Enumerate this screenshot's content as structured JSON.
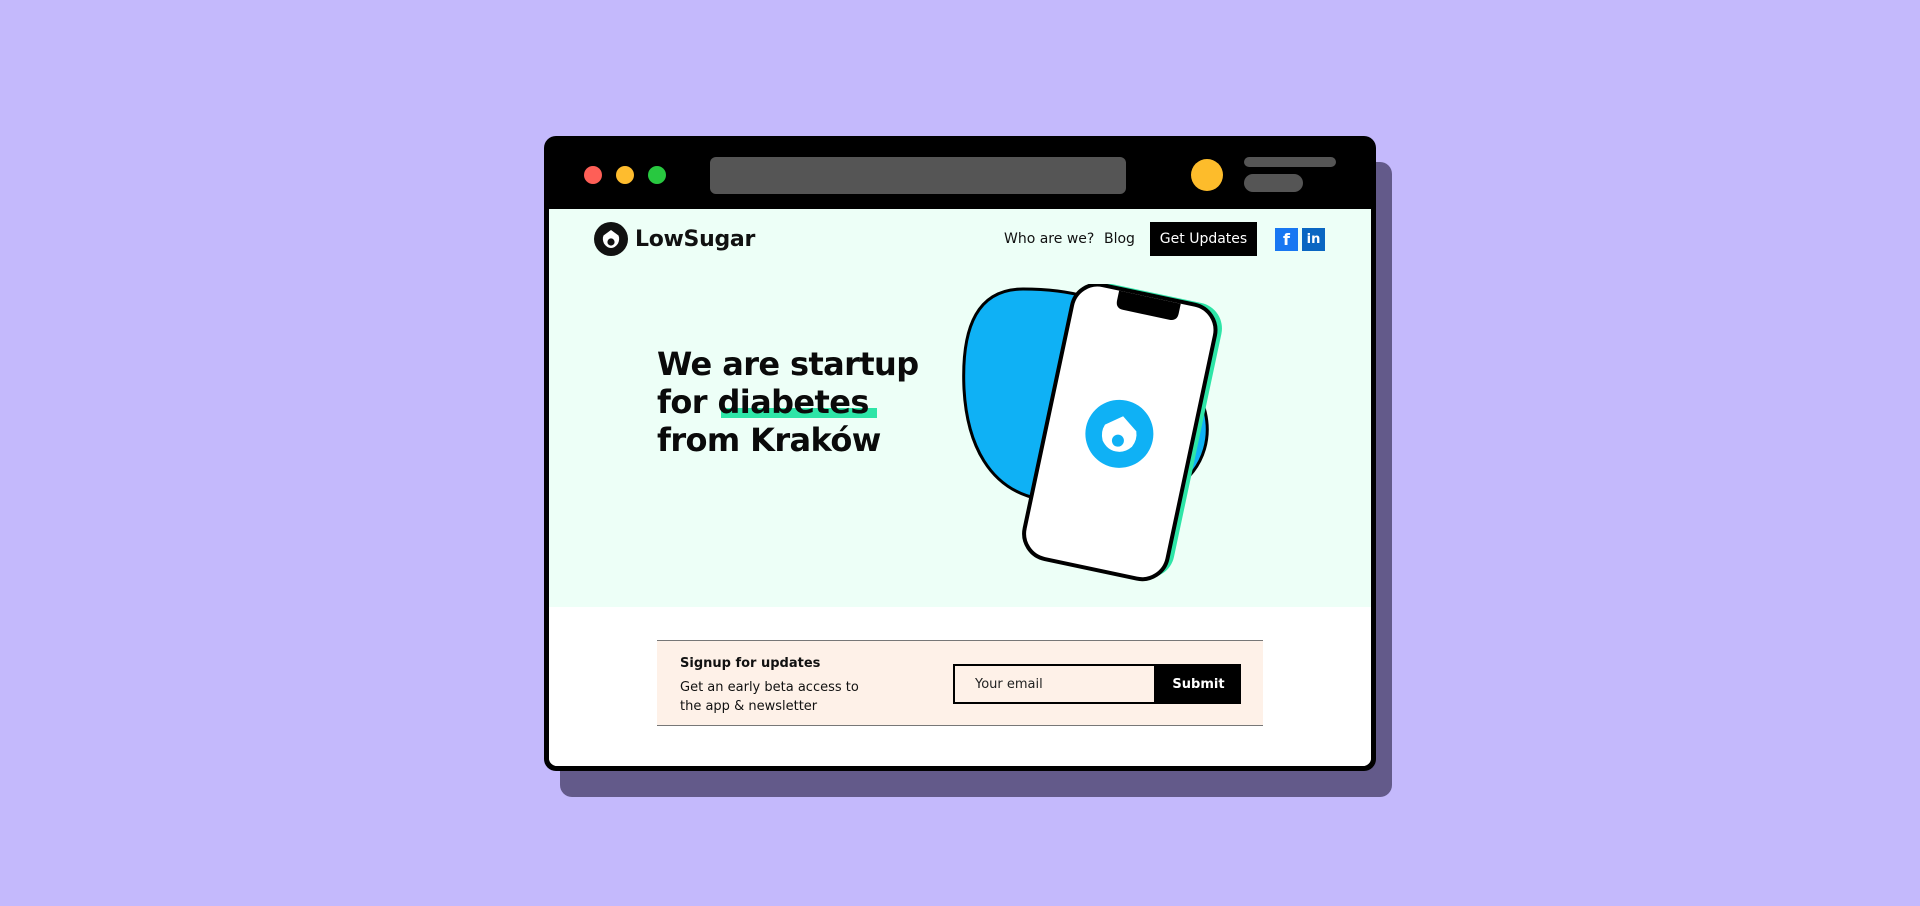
{
  "brand": {
    "name": "LowSugar"
  },
  "nav": {
    "links": [
      "Who are we?",
      "Blog"
    ],
    "cta_label": "Get Updates",
    "social": {
      "facebook": "f",
      "linkedin": "in"
    }
  },
  "hero": {
    "line1": "We are startup",
    "line2_prefix": "for ",
    "line2_highlight": "diabetes",
    "line3": "from Kraków"
  },
  "signup": {
    "title": "Signup for updates",
    "description": "Get an early beta access to the app & newsletter",
    "email_placeholder": "Your email",
    "submit_label": "Submit"
  },
  "colors": {
    "page_bg": "#c4b9fc",
    "hero_bg": "#edfff7",
    "highlight": "#2ee5a7",
    "blob": "#0fb1f5",
    "signup_bg": "#fef1e8",
    "facebook": "#1877f2",
    "linkedin": "#0a66c2"
  },
  "icons": [
    "logo-icon",
    "facebook-icon",
    "linkedin-icon",
    "phone-illustration"
  ]
}
